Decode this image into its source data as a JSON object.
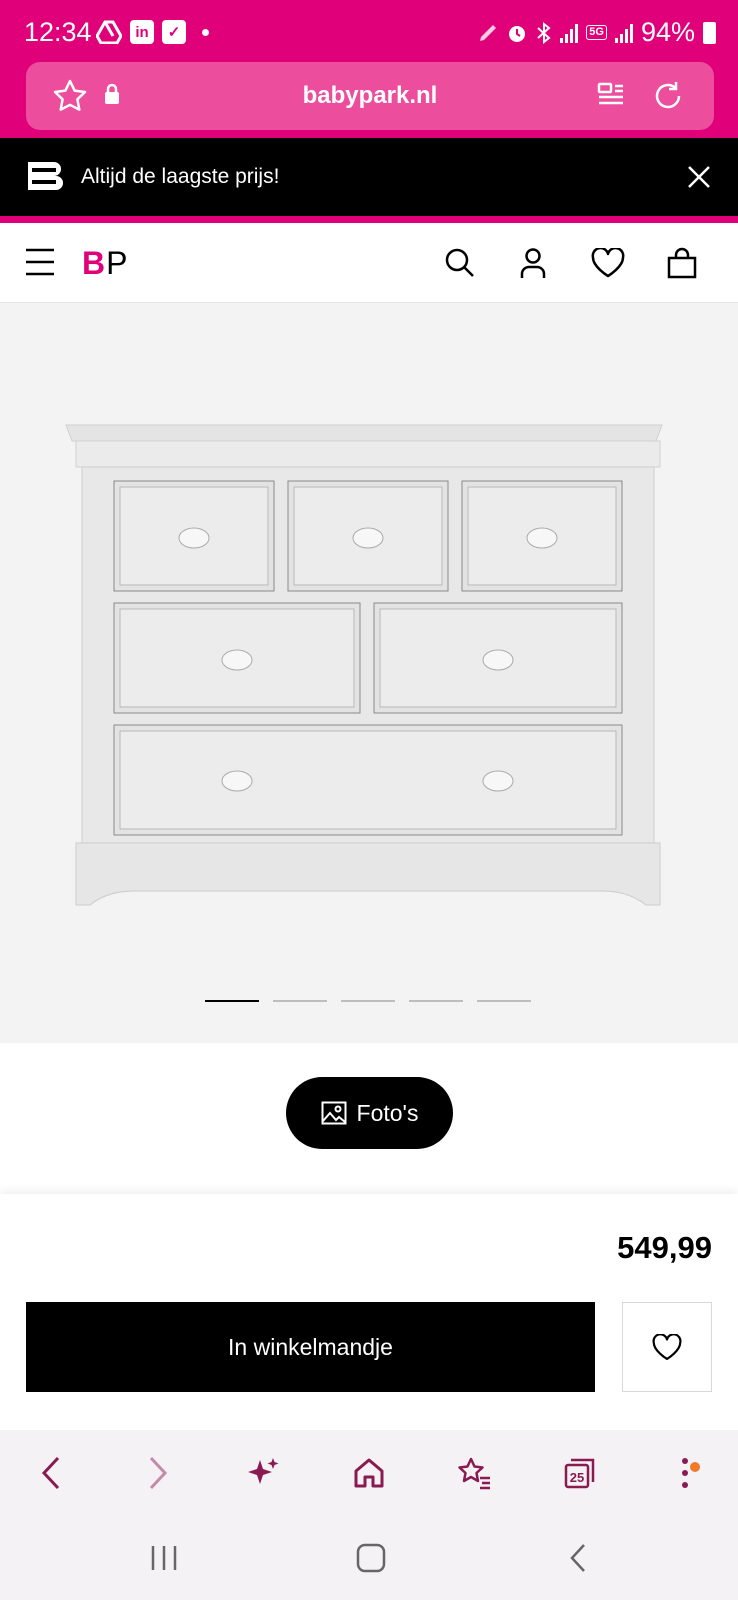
{
  "status_bar": {
    "time": "12:34",
    "battery": "94%"
  },
  "browser": {
    "url": "babypark.nl"
  },
  "promo_banner": {
    "text": "Altijd de laagste prijs!"
  },
  "site_header": {
    "logo_b": "B",
    "logo_p": "P"
  },
  "gallery": {
    "slide_count": 5,
    "active_slide": 1
  },
  "photos_button": {
    "label": "Foto's"
  },
  "product": {
    "price": "549,99",
    "add_to_cart_label": "In winkelmandje"
  },
  "browser_toolbar": {
    "tabs_count": "25"
  },
  "colors": {
    "brand": "#e0007a",
    "toolbar_icon": "#8a1a52"
  }
}
